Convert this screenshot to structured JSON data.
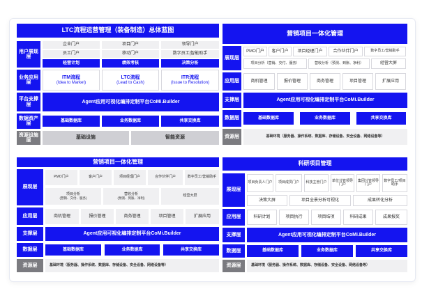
{
  "colors": {
    "accent": "#1414f0",
    "gray_bg": "#f0f0f2",
    "dark_gray": "#7b7b80"
  },
  "q1": {
    "title": "LTC流程运营管理（装备制造）总体蓝图",
    "layers": {
      "user": "用户展现层",
      "business": "业务应用层",
      "platform": "平台支撑层",
      "data": "数据资产层",
      "resource": "资源设施层"
    },
    "user_row1": [
      "企业门户",
      "项目门户",
      "领导门户"
    ],
    "user_row2": [
      "员工门户",
      "移动门户",
      "数字员工|智能助手"
    ],
    "user_row3": [
      "经营计划",
      "绩效考核",
      "决策分析"
    ],
    "biz": [
      {
        "name": "ITM流程",
        "sub": "(Idea to Market)"
      },
      {
        "name": "LTC流程",
        "sub": "(Lead to Cash)"
      },
      {
        "name": "ITR流程",
        "sub": "(Issue to Resolution)"
      }
    ],
    "platform_text": "Agent应用可视化编排定制平台CoMi.Builder",
    "data": [
      "基础数据库",
      "业务数据库",
      "共享交换库"
    ],
    "resource": [
      "基础设施",
      "智能资源"
    ]
  },
  "q2": {
    "title": "营销项目一体化管理",
    "layers": {
      "show": "展现层",
      "app": "应用层",
      "support": "支撑层",
      "data": "数据层",
      "resource": "资源层"
    },
    "show_row1": [
      "PMO门户",
      "客户门户",
      "项目经理门户",
      "合作伙伴门户",
      "数字员工/营销助手"
    ],
    "show_row2": [
      "项目分析（营销、交付、服务）",
      "营收分析（预测、到账、净利）",
      "经营大屏"
    ],
    "app": [
      "商机管理",
      "报价管理",
      "商务管理",
      "项目管理",
      "扩展应用"
    ],
    "support_text": "Agent应用可视化编排定制平台CoMi.Builder",
    "data": [
      "基础数据库",
      "业务数据库",
      "共享交换库"
    ],
    "resource_text": "基础环境（服务器、操作系统、数据库、存储设备、安全设备、网络设备等）"
  },
  "q3": {
    "title": "营销项目一体化管理",
    "layers": {
      "show": "展现层",
      "app": "应用层",
      "support": "支撑层",
      "data": "数据层",
      "resource": "资源层"
    },
    "show_row1": [
      "PMO门户",
      "客户门户",
      "项目经理门户",
      "合作伙伴门户",
      "数字员工/营销助手"
    ],
    "show_row2": [
      {
        "name": "项目分析",
        "sub": "(营销、交付、服务)"
      },
      {
        "name": "营收分析",
        "sub": "(预测、到账、净利)"
      },
      {
        "name": "经营大屏",
        "sub": ""
      }
    ],
    "app": [
      "商机管理",
      "报价管理",
      "商务管理",
      "项目管理",
      "扩展应用"
    ],
    "support_text": "Agent应用可视化编排定制平台CoMi.Builder",
    "data": [
      "基础数据库",
      "业务数据库",
      "共享交换库"
    ],
    "resource_text": "基础环境（服务器、操作系统、数据库、存储设备、安全设备、网络设备等）"
  },
  "q4": {
    "title": "科研项目管理",
    "layers": {
      "show": "展现层",
      "app": "应用层",
      "support": "支撑层",
      "data": "数据层",
      "resource": "资源层"
    },
    "show_row1": [
      "项目负责人门户",
      "项目成员门户",
      "科技主管门户",
      "单位分管领导门户",
      "集团分管领导门户",
      "数字员工/项目助手"
    ],
    "show_row2": [
      "决策大屏",
      "项目全景分析可视化",
      "成果转化分析"
    ],
    "app": [
      "科研计划",
      "项目执行",
      "项目结项",
      "科研成果",
      "成果报奖"
    ],
    "support_text": "Agent应用可视化编排定制平台CoMi.Builder",
    "data": [
      "基础数据库",
      "业务数据库",
      "共享交换库"
    ],
    "resource_text": "基础环境（服务器、操作系统、数据库、存储设备、安全设备、网络设备等）"
  }
}
